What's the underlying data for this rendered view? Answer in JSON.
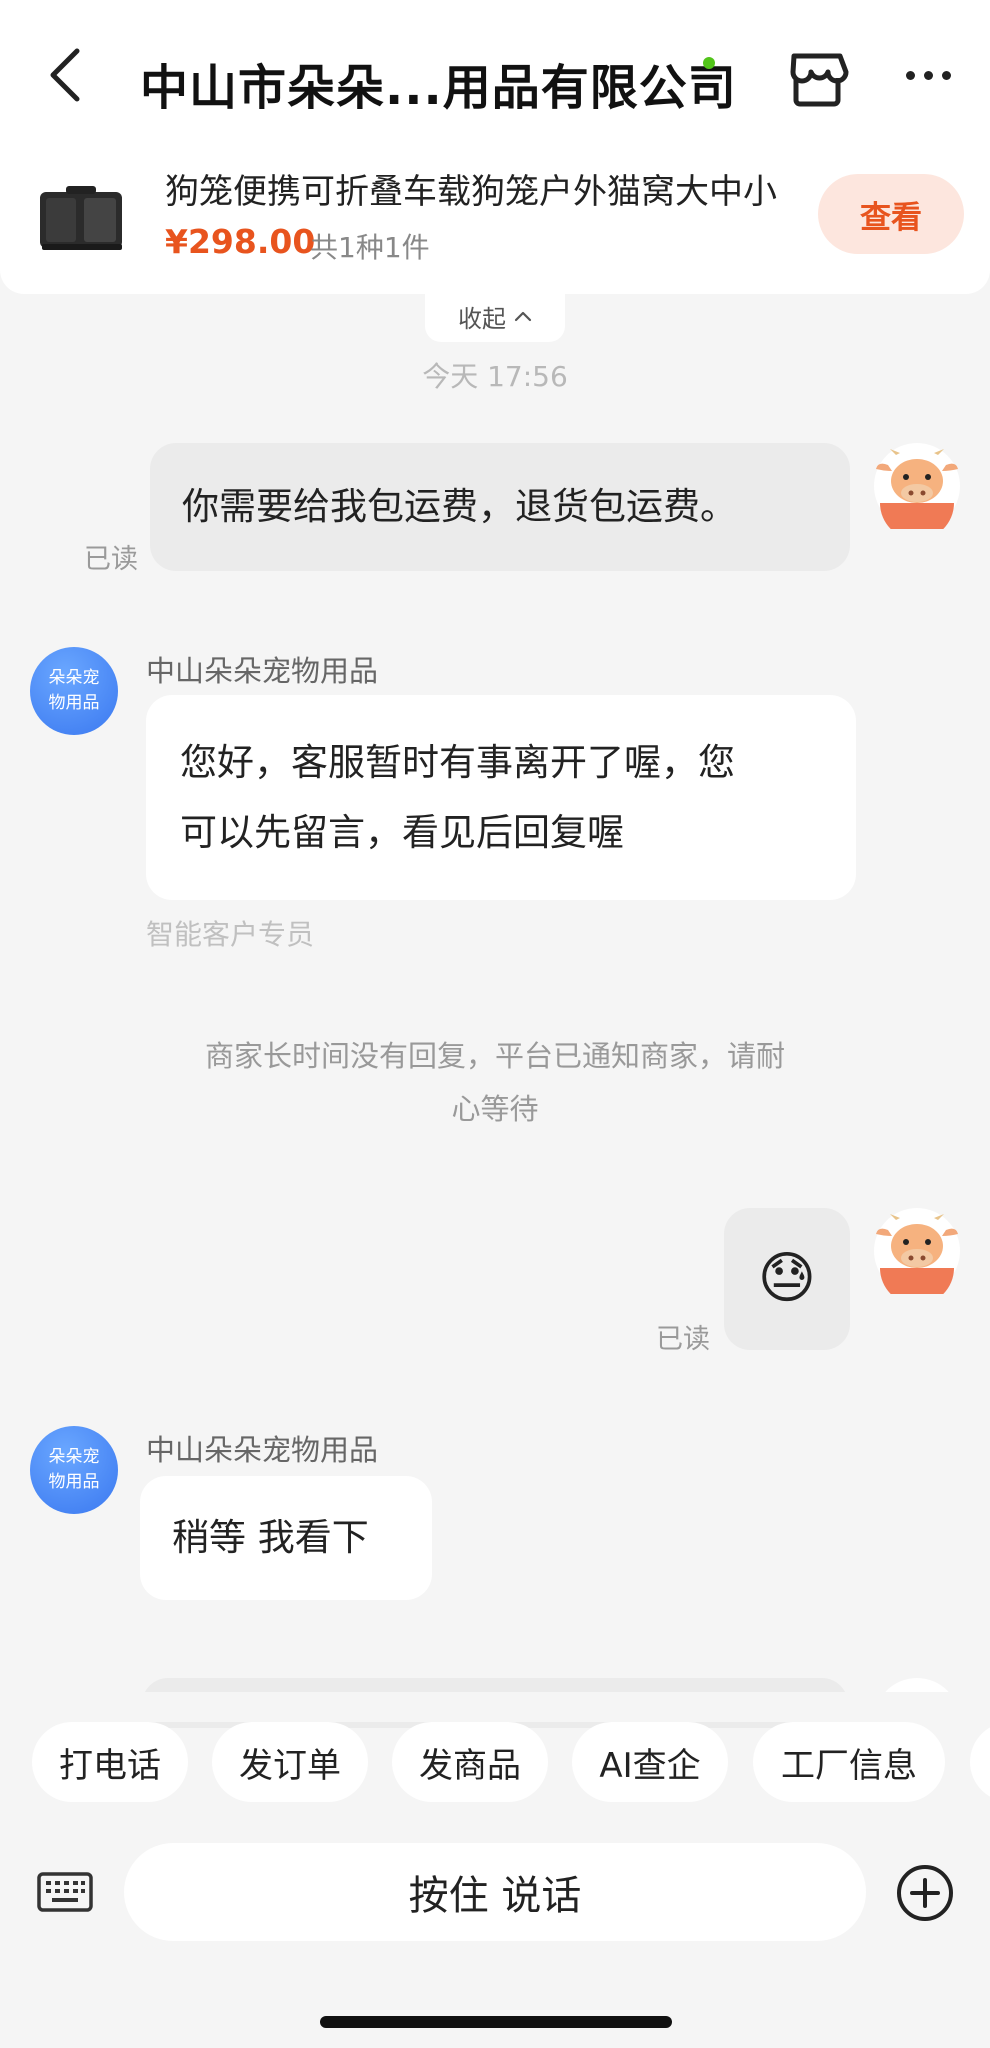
{
  "header": {
    "title": "中山市朵朵...用品有限公司"
  },
  "product": {
    "name": "狗笼便携可折叠车载狗笼户外猫窝大中小",
    "price": "¥298.00",
    "count": "共1种1件",
    "view_label": "查看"
  },
  "collapse_label": "收起",
  "timestamp": "今天 17:56",
  "messages": [
    {
      "text": "你需要给我包运费，退货包运费。",
      "read": "已读"
    },
    {
      "sender": "中山朵朵宠物用品",
      "text_line1": "您好，客服暂时有事离开了喔，您",
      "text_line2": "可以先留言，看见后回复喔",
      "sub": "智能客户专员"
    },
    {
      "emoji": "😓",
      "read": "已读"
    },
    {
      "sender": "中山朵朵宠物用品",
      "text": "稍等 我看下"
    }
  ],
  "shop_avatar": {
    "line1": "朵朵宠",
    "line2": "物用品"
  },
  "system_notice_line1": "商家长时间没有回复，平台已通知商家，请耐",
  "system_notice_line2": "心等待",
  "quick_actions": [
    "打电话",
    "发订单",
    "发商品",
    "AI查企",
    "工厂信息"
  ],
  "input": {
    "voice_label": "按住 说话"
  },
  "colors": {
    "accent": "#e8541e",
    "accent_bg": "#fde6de",
    "online": "#52c41a",
    "shop_avatar": "#3a78f0"
  },
  "icons": [
    "back-icon",
    "store-icon",
    "more-icon",
    "chevron-up-icon",
    "keyboard-icon",
    "plus-circle-icon",
    "cow-avatar-icon"
  ]
}
